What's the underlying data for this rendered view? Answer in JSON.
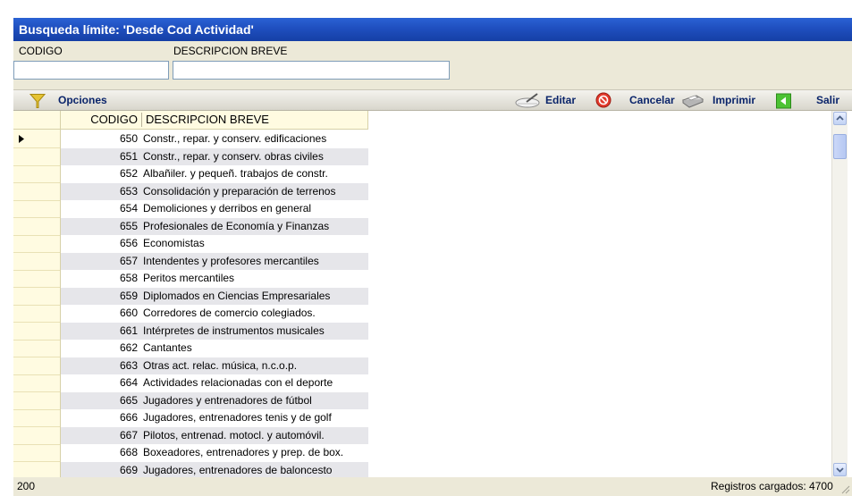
{
  "window": {
    "title": "Busqueda límite: 'Desde Cod Actividad'"
  },
  "filters": {
    "codigo_label": "CODIGO",
    "descripcion_label": "DESCRIPCION BREVE",
    "codigo_value": "",
    "descripcion_value": ""
  },
  "toolbar": {
    "opciones": "Opciones",
    "editar": "Editar",
    "cancelar": "Cancelar",
    "imprimir": "Imprimir",
    "salir": "Salir"
  },
  "grid": {
    "columns": [
      "CODIGO",
      "DESCRIPCION BREVE"
    ],
    "rows": [
      {
        "codigo": "650",
        "descripcion": "Constr., repar. y conserv. edificaciones"
      },
      {
        "codigo": "651",
        "descripcion": "Constr., repar. y conserv. obras civiles"
      },
      {
        "codigo": "652",
        "descripcion": "Albañiler. y pequeñ. trabajos de constr."
      },
      {
        "codigo": "653",
        "descripcion": "Consolidación y preparación de terrenos"
      },
      {
        "codigo": "654",
        "descripcion": "Demoliciones y derribos en general"
      },
      {
        "codigo": "655",
        "descripcion": "Profesionales de Economía y Finanzas"
      },
      {
        "codigo": "656",
        "descripcion": "Economistas"
      },
      {
        "codigo": "657",
        "descripcion": "Intendentes y profesores mercantiles"
      },
      {
        "codigo": "658",
        "descripcion": "Peritos mercantiles"
      },
      {
        "codigo": "659",
        "descripcion": "Diplomados en Ciencias Empresariales"
      },
      {
        "codigo": "660",
        "descripcion": "Corredores de comercio colegiados."
      },
      {
        "codigo": "661",
        "descripcion": "Intérpretes de instrumentos musicales"
      },
      {
        "codigo": "662",
        "descripcion": "Cantantes"
      },
      {
        "codigo": "663",
        "descripcion": "Otras act. relac. música, n.c.o.p."
      },
      {
        "codigo": "664",
        "descripcion": "Actividades relacionadas con el deporte"
      },
      {
        "codigo": "665",
        "descripcion": "Jugadores y entrenadores de fútbol"
      },
      {
        "codigo": "666",
        "descripcion": "Jugadores, entrenadores tenis y de golf"
      },
      {
        "codigo": "667",
        "descripcion": "Pilotos, entrenad. motocl. y automóvil."
      },
      {
        "codigo": "668",
        "descripcion": "Boxeadores, entrenadores y prep. de box."
      },
      {
        "codigo": "669",
        "descripcion": "Jugadores, entrenadores de baloncesto"
      }
    ],
    "selected_index": 0
  },
  "status": {
    "count": "200",
    "registros": "Registros cargados: 4700"
  },
  "colors": {
    "titlebar": "#1f4fbf",
    "header_bg": "#fffbe1",
    "alt_row": "#e6e6ea",
    "toolbar_text": "#0a246a"
  }
}
